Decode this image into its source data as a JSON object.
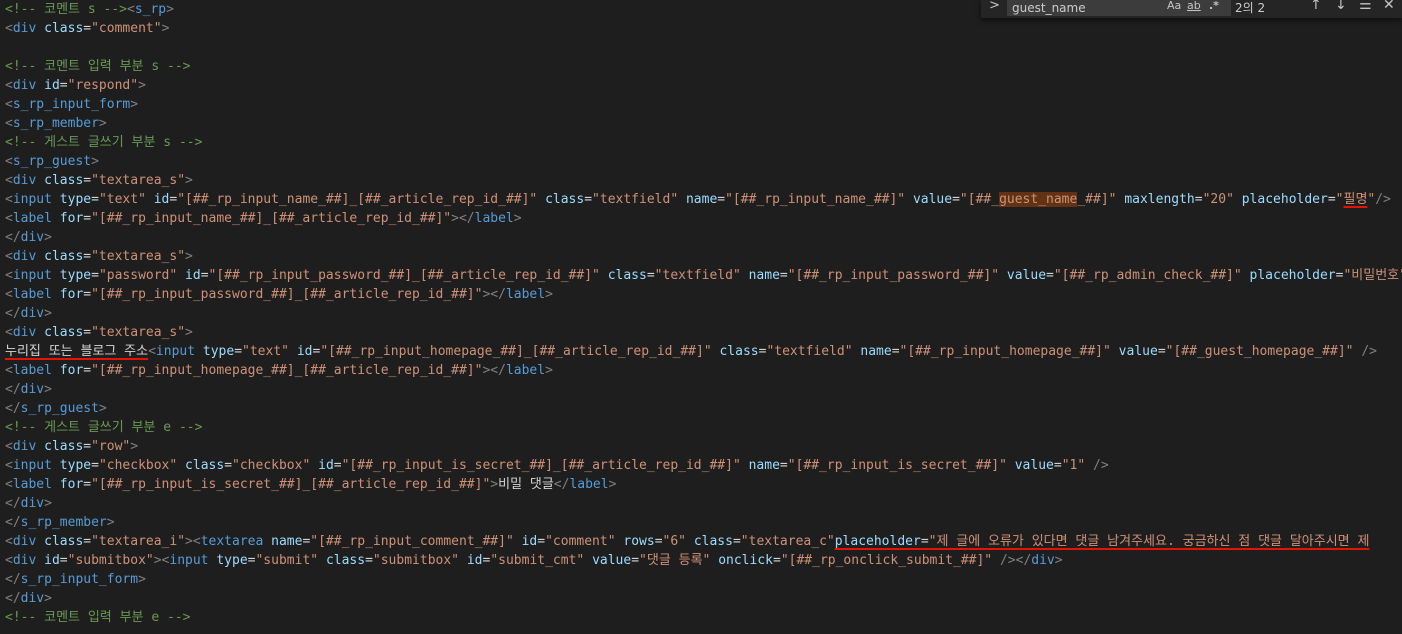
{
  "find_widget": {
    "toggle_glyph": ">",
    "query": "guest_name",
    "match_case_label": "Aa",
    "whole_word_label": "ab",
    "regex_label": ".*",
    "match_count": "2의 2",
    "prev_glyph": "↑",
    "next_glyph": "↓",
    "selection_glyph": "☰",
    "close_glyph": "✕"
  },
  "highlight_color": "#613214",
  "annotation_color": "#e51400",
  "code_lines": [
    [
      [
        "cmt",
        "<!-- 코멘트 s -->"
      ],
      [
        "pct",
        "<"
      ],
      [
        "tag",
        "s_rp"
      ],
      [
        "pct",
        ">"
      ]
    ],
    [
      [
        "pct",
        "<"
      ],
      [
        "tag",
        "div"
      ],
      [
        "txt",
        " "
      ],
      [
        "attr",
        "class"
      ],
      [
        "eq",
        "="
      ],
      [
        "str",
        "\"comment\""
      ],
      [
        "pct",
        ">"
      ]
    ],
    [],
    [
      [
        "cmt",
        "<!-- 코멘트 입력 부분 s -->"
      ]
    ],
    [
      [
        "pct",
        "<"
      ],
      [
        "tag",
        "div"
      ],
      [
        "txt",
        " "
      ],
      [
        "attr",
        "id"
      ],
      [
        "eq",
        "="
      ],
      [
        "str",
        "\"respond\""
      ],
      [
        "pct",
        ">"
      ]
    ],
    [
      [
        "pct",
        "<"
      ],
      [
        "tag",
        "s_rp_input_form"
      ],
      [
        "pct",
        ">"
      ]
    ],
    [
      [
        "pct",
        "<"
      ],
      [
        "tag",
        "s_rp_member"
      ],
      [
        "pct",
        ">"
      ]
    ],
    [
      [
        "cmt",
        "<!-- 게스트 글쓰기 부분 s -->"
      ]
    ],
    [
      [
        "pct",
        "<"
      ],
      [
        "tag",
        "s_rp_guest"
      ],
      [
        "pct",
        ">"
      ]
    ],
    [
      [
        "pct",
        "<"
      ],
      [
        "tag",
        "div"
      ],
      [
        "txt",
        " "
      ],
      [
        "attr",
        "class"
      ],
      [
        "eq",
        "="
      ],
      [
        "str",
        "\"textarea_s\""
      ],
      [
        "pct",
        ">"
      ]
    ],
    [
      [
        "pct",
        "<"
      ],
      [
        "tag",
        "input"
      ],
      [
        "txt",
        " "
      ],
      [
        "attr",
        "type"
      ],
      [
        "eq",
        "="
      ],
      [
        "str",
        "\"text\""
      ],
      [
        "txt",
        " "
      ],
      [
        "attr",
        "id"
      ],
      [
        "eq",
        "="
      ],
      [
        "str",
        "\"[##_rp_input_name_##]_[##_article_rep_id_##]\""
      ],
      [
        "txt",
        " "
      ],
      [
        "attr",
        "class"
      ],
      [
        "eq",
        "="
      ],
      [
        "str",
        "\"textfield\""
      ],
      [
        "txt",
        " "
      ],
      [
        "attr",
        "name"
      ],
      [
        "eq",
        "="
      ],
      [
        "str",
        "\"[##_rp_input_name_##]\""
      ],
      [
        "txt",
        " "
      ],
      [
        "attr",
        "value"
      ],
      [
        "eq",
        "="
      ],
      [
        "str",
        "\"[##_"
      ],
      [
        "str hl",
        "guest_name"
      ],
      [
        "str",
        "_##]\""
      ],
      [
        "txt",
        " "
      ],
      [
        "attr",
        "maxlength"
      ],
      [
        "eq",
        "="
      ],
      [
        "str",
        "\"20\""
      ],
      [
        "txt",
        " "
      ],
      [
        "attr",
        "placeholder"
      ],
      [
        "eq",
        "="
      ],
      [
        "str",
        "\""
      ],
      [
        "str uline",
        "필명"
      ],
      [
        "str",
        "\""
      ],
      [
        "pct",
        "/>"
      ]
    ],
    [
      [
        "pct",
        "<"
      ],
      [
        "tag",
        "label"
      ],
      [
        "txt",
        " "
      ],
      [
        "attr",
        "for"
      ],
      [
        "eq",
        "="
      ],
      [
        "str",
        "\"[##_rp_input_name_##]_[##_article_rep_id_##]\""
      ],
      [
        "pct",
        "></"
      ],
      [
        "tag",
        "label"
      ],
      [
        "pct",
        ">"
      ]
    ],
    [
      [
        "pct",
        "</"
      ],
      [
        "tag",
        "div"
      ],
      [
        "pct",
        ">"
      ]
    ],
    [
      [
        "pct",
        "<"
      ],
      [
        "tag",
        "div"
      ],
      [
        "txt",
        " "
      ],
      [
        "attr",
        "class"
      ],
      [
        "eq",
        "="
      ],
      [
        "str",
        "\"textarea_s\""
      ],
      [
        "pct",
        ">"
      ]
    ],
    [
      [
        "pct",
        "<"
      ],
      [
        "tag",
        "input"
      ],
      [
        "txt",
        " "
      ],
      [
        "attr",
        "type"
      ],
      [
        "eq",
        "="
      ],
      [
        "str",
        "\"password\""
      ],
      [
        "txt",
        " "
      ],
      [
        "attr",
        "id"
      ],
      [
        "eq",
        "="
      ],
      [
        "str",
        "\"[##_rp_input_password_##]_[##_article_rep_id_##]\""
      ],
      [
        "txt",
        " "
      ],
      [
        "attr",
        "class"
      ],
      [
        "eq",
        "="
      ],
      [
        "str",
        "\"textfield\""
      ],
      [
        "txt",
        " "
      ],
      [
        "attr",
        "name"
      ],
      [
        "eq",
        "="
      ],
      [
        "str",
        "\"[##_rp_input_password_##]\""
      ],
      [
        "txt",
        " "
      ],
      [
        "attr",
        "value"
      ],
      [
        "eq",
        "="
      ],
      [
        "str",
        "\"[##_rp_admin_check_##]\""
      ],
      [
        "txt",
        " "
      ],
      [
        "attr",
        "placeholder"
      ],
      [
        "eq",
        "="
      ],
      [
        "str",
        "\"비밀번호\""
      ],
      [
        "pct",
        "/>"
      ]
    ],
    [
      [
        "pct",
        "<"
      ],
      [
        "tag",
        "label"
      ],
      [
        "txt",
        " "
      ],
      [
        "attr",
        "for"
      ],
      [
        "eq",
        "="
      ],
      [
        "str",
        "\"[##_rp_input_password_##]_[##_article_rep_id_##]\""
      ],
      [
        "pct",
        "></"
      ],
      [
        "tag",
        "label"
      ],
      [
        "pct",
        ">"
      ]
    ],
    [
      [
        "pct",
        "</"
      ],
      [
        "tag",
        "div"
      ],
      [
        "pct",
        ">"
      ]
    ],
    [
      [
        "pct",
        "<"
      ],
      [
        "tag",
        "div"
      ],
      [
        "txt",
        " "
      ],
      [
        "attr",
        "class"
      ],
      [
        "eq",
        "="
      ],
      [
        "str",
        "\"textarea_s\""
      ],
      [
        "pct",
        ">"
      ]
    ],
    [
      [
        "txt uline",
        "누리집 또는 블로그 주소"
      ],
      [
        "pct",
        "<"
      ],
      [
        "tag",
        "input"
      ],
      [
        "txt",
        " "
      ],
      [
        "attr",
        "type"
      ],
      [
        "eq",
        "="
      ],
      [
        "str",
        "\"text\""
      ],
      [
        "txt",
        " "
      ],
      [
        "attr",
        "id"
      ],
      [
        "eq",
        "="
      ],
      [
        "str",
        "\"[##_rp_input_homepage_##]_[##_article_rep_id_##]\""
      ],
      [
        "txt",
        " "
      ],
      [
        "attr",
        "class"
      ],
      [
        "eq",
        "="
      ],
      [
        "str",
        "\"textfield\""
      ],
      [
        "txt",
        " "
      ],
      [
        "attr",
        "name"
      ],
      [
        "eq",
        "="
      ],
      [
        "str",
        "\"[##_rp_input_homepage_##]\""
      ],
      [
        "txt",
        " "
      ],
      [
        "attr",
        "value"
      ],
      [
        "eq",
        "="
      ],
      [
        "str",
        "\"[##_guest_homepage_##]\""
      ],
      [
        "txt",
        " "
      ],
      [
        "pct",
        "/>"
      ]
    ],
    [
      [
        "pct",
        "<"
      ],
      [
        "tag",
        "label"
      ],
      [
        "txt",
        " "
      ],
      [
        "attr",
        "for"
      ],
      [
        "eq",
        "="
      ],
      [
        "str",
        "\"[##_rp_input_homepage_##]_[##_article_rep_id_##]\""
      ],
      [
        "pct",
        "></"
      ],
      [
        "tag",
        "label"
      ],
      [
        "pct",
        ">"
      ]
    ],
    [
      [
        "pct",
        "</"
      ],
      [
        "tag",
        "div"
      ],
      [
        "pct",
        ">"
      ]
    ],
    [
      [
        "pct",
        "</"
      ],
      [
        "tag",
        "s_rp_guest"
      ],
      [
        "pct",
        ">"
      ]
    ],
    [
      [
        "cmt",
        "<!-- 게스트 글쓰기 부분 e -->"
      ]
    ],
    [
      [
        "pct",
        "<"
      ],
      [
        "tag",
        "div"
      ],
      [
        "txt",
        " "
      ],
      [
        "attr",
        "class"
      ],
      [
        "eq",
        "="
      ],
      [
        "str",
        "\"row\""
      ],
      [
        "pct",
        ">"
      ]
    ],
    [
      [
        "pct",
        "<"
      ],
      [
        "tag",
        "input"
      ],
      [
        "txt",
        " "
      ],
      [
        "attr",
        "type"
      ],
      [
        "eq",
        "="
      ],
      [
        "str",
        "\"checkbox\""
      ],
      [
        "txt",
        " "
      ],
      [
        "attr",
        "class"
      ],
      [
        "eq",
        "="
      ],
      [
        "str",
        "\"checkbox\""
      ],
      [
        "txt",
        " "
      ],
      [
        "attr",
        "id"
      ],
      [
        "eq",
        "="
      ],
      [
        "str",
        "\"[##_rp_input_is_secret_##]_[##_article_rep_id_##]\""
      ],
      [
        "txt",
        " "
      ],
      [
        "attr",
        "name"
      ],
      [
        "eq",
        "="
      ],
      [
        "str",
        "\"[##_rp_input_is_secret_##]\""
      ],
      [
        "txt",
        " "
      ],
      [
        "attr",
        "value"
      ],
      [
        "eq",
        "="
      ],
      [
        "str",
        "\"1\""
      ],
      [
        "txt",
        " "
      ],
      [
        "pct",
        "/>"
      ]
    ],
    [
      [
        "pct",
        "<"
      ],
      [
        "tag",
        "label"
      ],
      [
        "txt",
        " "
      ],
      [
        "attr",
        "for"
      ],
      [
        "eq",
        "="
      ],
      [
        "str",
        "\"[##_rp_input_is_secret_##]_[##_article_rep_id_##]\""
      ],
      [
        "pct",
        ">"
      ],
      [
        "txt",
        "비밀 댓글"
      ],
      [
        "pct",
        "</"
      ],
      [
        "tag",
        "label"
      ],
      [
        "pct",
        ">"
      ]
    ],
    [
      [
        "pct",
        "</"
      ],
      [
        "tag",
        "div"
      ],
      [
        "pct",
        ">"
      ]
    ],
    [
      [
        "pct",
        "</"
      ],
      [
        "tag",
        "s_rp_member"
      ],
      [
        "pct",
        ">"
      ]
    ],
    [
      [
        "pct",
        "<"
      ],
      [
        "tag",
        "div"
      ],
      [
        "txt",
        " "
      ],
      [
        "attr",
        "class"
      ],
      [
        "eq",
        "="
      ],
      [
        "str",
        "\"textarea_i\""
      ],
      [
        "pct",
        "><"
      ],
      [
        "tag",
        "textarea"
      ],
      [
        "txt",
        " "
      ],
      [
        "attr",
        "name"
      ],
      [
        "eq",
        "="
      ],
      [
        "str",
        "\"[##_rp_input_comment_##]\""
      ],
      [
        "txt",
        " "
      ],
      [
        "attr",
        "id"
      ],
      [
        "eq",
        "="
      ],
      [
        "str",
        "\"comment\""
      ],
      [
        "txt",
        " "
      ],
      [
        "attr",
        "rows"
      ],
      [
        "eq",
        "="
      ],
      [
        "str",
        "\"6\""
      ],
      [
        "txt",
        " "
      ],
      [
        "attr",
        "class"
      ],
      [
        "eq",
        "="
      ],
      [
        "str",
        "\"textarea_c\""
      ],
      [
        "attr uline",
        "placeholder"
      ],
      [
        "eq uline",
        "="
      ],
      [
        "str uline",
        "\"제 글에 오류가 있다면 댓글 남겨주세요. 궁금하신 점 댓글 달아주시면 제"
      ]
    ],
    [
      [
        "pct",
        "<"
      ],
      [
        "tag",
        "div"
      ],
      [
        "txt",
        " "
      ],
      [
        "attr",
        "id"
      ],
      [
        "eq",
        "="
      ],
      [
        "str",
        "\"submitbox\""
      ],
      [
        "pct",
        "><"
      ],
      [
        "tag",
        "input"
      ],
      [
        "txt",
        " "
      ],
      [
        "attr",
        "type"
      ],
      [
        "eq",
        "="
      ],
      [
        "str",
        "\"submit\""
      ],
      [
        "txt",
        " "
      ],
      [
        "attr",
        "class"
      ],
      [
        "eq",
        "="
      ],
      [
        "str",
        "\"submitbox\""
      ],
      [
        "txt",
        " "
      ],
      [
        "attr",
        "id"
      ],
      [
        "eq",
        "="
      ],
      [
        "str",
        "\"submit_cmt\""
      ],
      [
        "txt",
        " "
      ],
      [
        "attr",
        "value"
      ],
      [
        "eq",
        "="
      ],
      [
        "str",
        "\"댓글 등록\""
      ],
      [
        "txt",
        " "
      ],
      [
        "attr",
        "onclick"
      ],
      [
        "eq",
        "="
      ],
      [
        "str",
        "\"[##_rp_onclick_submit_##]\""
      ],
      [
        "txt",
        " "
      ],
      [
        "pct",
        "/></"
      ],
      [
        "tag",
        "div"
      ],
      [
        "pct",
        ">"
      ]
    ],
    [
      [
        "pct",
        "</"
      ],
      [
        "tag",
        "s_rp_input_form"
      ],
      [
        "pct",
        ">"
      ]
    ],
    [
      [
        "pct",
        "</"
      ],
      [
        "tag",
        "div"
      ],
      [
        "pct",
        ">"
      ]
    ],
    [
      [
        "cmt",
        "<!-- 코멘트 입력 부분 e -->"
      ]
    ]
  ]
}
